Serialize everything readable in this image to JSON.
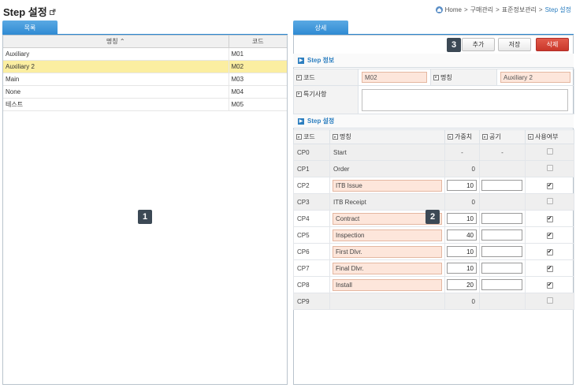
{
  "page_title": "Step 설정",
  "breadcrumb": [
    "Home",
    "구매관리",
    "표준정보관리",
    "Step 설정"
  ],
  "breadcrumb_sep": ">",
  "left": {
    "tab_label": "목록",
    "columns": {
      "name": "명칭 ⌃",
      "code": "코드"
    },
    "rows": [
      {
        "name": "Auxiliary",
        "code": "M01",
        "selected": false
      },
      {
        "name": "Auxiliary 2",
        "code": "M02",
        "selected": true
      },
      {
        "name": "Main",
        "code": "M03",
        "selected": false
      },
      {
        "name": "None",
        "code": "M04",
        "selected": false
      },
      {
        "name": "테스트",
        "code": "M05",
        "selected": false
      }
    ]
  },
  "right": {
    "tab_label": "상세",
    "buttons": {
      "add": "추가",
      "save": "저장",
      "delete": "삭제"
    },
    "step_info": {
      "title": "Step 정보",
      "code_label": "코드",
      "code_value": "M02",
      "name_label": "명칭",
      "name_value": "Auxiliary 2",
      "remark_label": "특기사항"
    },
    "step_settings": {
      "title": "Step 설정",
      "columns": {
        "code": "코드",
        "name": "명칭",
        "weight": "가중치",
        "period": "공기",
        "use": "사용여부"
      },
      "rows": [
        {
          "code": "CP0",
          "name": "Start",
          "editable": false,
          "weight": "-",
          "period": "-",
          "use": false,
          "alt": true
        },
        {
          "code": "CP1",
          "name": "Order",
          "editable": false,
          "weight": "0",
          "period": "",
          "use": false,
          "alt": true
        },
        {
          "code": "CP2",
          "name": "ITB Issue",
          "editable": true,
          "weight": "10",
          "period": "",
          "use": true,
          "alt": false
        },
        {
          "code": "CP3",
          "name": "ITB Receipt",
          "editable": false,
          "weight": "0",
          "period": "",
          "use": false,
          "alt": true
        },
        {
          "code": "CP4",
          "name": "Contract",
          "editable": true,
          "weight": "10",
          "period": "",
          "use": true,
          "alt": false
        },
        {
          "code": "CP5",
          "name": "Inspection",
          "editable": true,
          "weight": "40",
          "period": "",
          "use": true,
          "alt": false
        },
        {
          "code": "CP6",
          "name": "First Dlvr.",
          "editable": true,
          "weight": "10",
          "period": "",
          "use": true,
          "alt": false
        },
        {
          "code": "CP7",
          "name": "Final Dlvr.",
          "editable": true,
          "weight": "10",
          "period": "",
          "use": true,
          "alt": false
        },
        {
          "code": "CP8",
          "name": "Install",
          "editable": true,
          "weight": "20",
          "period": "",
          "use": true,
          "alt": false
        },
        {
          "code": "CP9",
          "name": "",
          "editable": false,
          "weight": "0",
          "period": "",
          "use": false,
          "alt": true
        }
      ]
    }
  },
  "markers": [
    "1",
    "2",
    "3"
  ]
}
